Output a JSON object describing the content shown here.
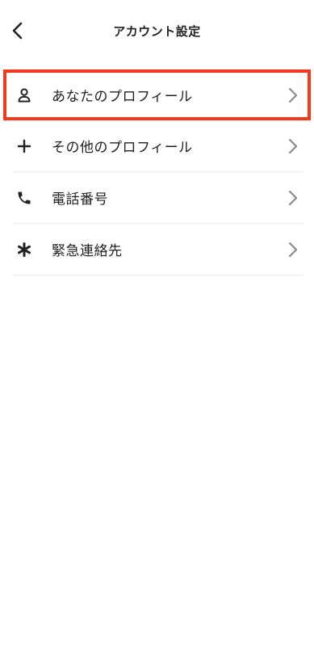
{
  "header": {
    "title": "アカウント設定",
    "back_icon": "chevron-left-icon"
  },
  "menu": {
    "items": [
      {
        "label": "あなたのプロフィール",
        "icon": "person-icon",
        "highlighted": true
      },
      {
        "label": "その他のプロフィール",
        "icon": "plus-icon",
        "highlighted": false
      },
      {
        "label": "電話番号",
        "icon": "phone-icon",
        "highlighted": false
      },
      {
        "label": "緊急連絡先",
        "icon": "asterisk-icon",
        "highlighted": false
      }
    ],
    "chevron_icon": "chevron-right-icon"
  },
  "colors": {
    "highlight_border": "#f4391c",
    "text": "#222222",
    "chevron": "#8a8a8a",
    "divider": "#e9e9e9"
  }
}
